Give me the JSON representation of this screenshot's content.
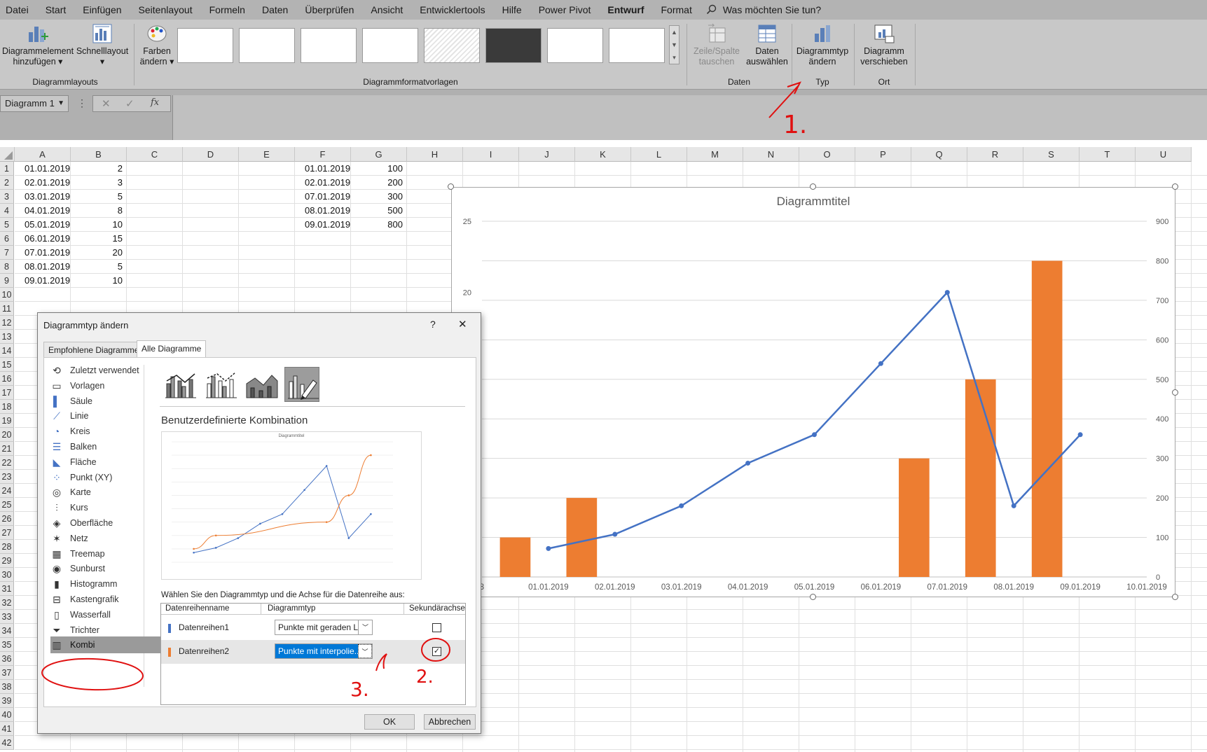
{
  "menu": {
    "items": [
      "Datei",
      "Start",
      "Einfügen",
      "Seitenlayout",
      "Formeln",
      "Daten",
      "Überprüfen",
      "Ansicht",
      "Entwicklertools",
      "Hilfe",
      "Power Pivot",
      "Entwurf",
      "Format"
    ],
    "active": "Entwurf",
    "search_placeholder": "Was möchten Sie tun?"
  },
  "ribbon": {
    "add_element": [
      "Diagrammelement",
      "hinzufügen"
    ],
    "quick_layout": "Schnelllayout",
    "change_colors": [
      "Farben",
      "ändern"
    ],
    "group_layouts": "Diagrammlayouts",
    "group_styles": "Diagrammformatvorlagen",
    "switch_rowcol": [
      "Zeile/Spalte",
      "tauschen"
    ],
    "select_data": [
      "Daten",
      "auswählen"
    ],
    "group_data": "Daten",
    "change_type": [
      "Diagrammtyp",
      "ändern"
    ],
    "group_type": "Typ",
    "move_chart": [
      "Diagramm",
      "verschieben"
    ],
    "group_location": "Ort"
  },
  "formula_bar": {
    "name_box": "Diagramm 1",
    "fx": "fx"
  },
  "sheet": {
    "columns": [
      "A",
      "B",
      "C",
      "D",
      "E",
      "F",
      "G",
      "H",
      "I",
      "J",
      "K",
      "L",
      "M",
      "N",
      "O",
      "P",
      "Q",
      "R",
      "S",
      "T",
      "U"
    ],
    "rows": [
      "1",
      "2",
      "3",
      "4",
      "5",
      "6",
      "7",
      "8",
      "9",
      "10",
      "11",
      "12",
      "13",
      "14",
      "15",
      "16",
      "17",
      "18",
      "19",
      "20",
      "21",
      "22",
      "23",
      "24",
      "25",
      "26",
      "27",
      "28",
      "29",
      "30",
      "31",
      "32",
      "33",
      "34",
      "35",
      "36",
      "37",
      "38",
      "39",
      "40",
      "41",
      "42"
    ],
    "col_a": [
      "01.01.2019",
      "02.01.2019",
      "03.01.2019",
      "04.01.2019",
      "05.01.2019",
      "06.01.2019",
      "07.01.2019",
      "08.01.2019",
      "09.01.2019"
    ],
    "col_b": [
      "2",
      "3",
      "5",
      "8",
      "10",
      "15",
      "20",
      "5",
      "10"
    ],
    "col_f": [
      "01.01.2019",
      "02.01.2019",
      "07.01.2019",
      "08.01.2019",
      "09.01.2019"
    ],
    "col_g": [
      "100",
      "200",
      "300",
      "500",
      "800"
    ]
  },
  "chart_data": {
    "type": "bar",
    "title": "Diagrammtitel",
    "x_tick_labels": [
      "2018",
      "01.01.2019",
      "02.01.2019",
      "03.01.2019",
      "04.01.2019",
      "05.01.2019",
      "06.01.2019",
      "07.01.2019",
      "08.01.2019",
      "09.01.2019",
      "10.01.2019"
    ],
    "y_left_ticks": [
      "25",
      "20"
    ],
    "y_right_ticks": [
      "900",
      "800",
      "700",
      "600",
      "500",
      "400",
      "300",
      "200",
      "100",
      "0"
    ],
    "ylim_left": [
      0,
      25
    ],
    "ylim_right": [
      0,
      900
    ],
    "grid": true,
    "series": [
      {
        "chart": "line",
        "axis": "primary",
        "color": "#4472c4",
        "x": [
          "01.01.2019",
          "02.01.2019",
          "03.01.2019",
          "04.01.2019",
          "05.01.2019",
          "06.01.2019",
          "07.01.2019",
          "08.01.2019",
          "09.01.2019"
        ],
        "values": [
          2,
          3,
          5,
          8,
          10,
          15,
          20,
          5,
          10
        ]
      },
      {
        "chart": "bar",
        "axis": "secondary",
        "color": "#ed7d31",
        "x": [
          "01.01.2019",
          "02.01.2019",
          "07.01.2019",
          "08.01.2019",
          "09.01.2019"
        ],
        "values": [
          100,
          200,
          300,
          500,
          800
        ]
      }
    ]
  },
  "dialog": {
    "title": "Diagrammtyp ändern",
    "help": "?",
    "close": "✕",
    "tabs": [
      "Empfohlene Diagramme",
      "Alle Diagramme"
    ],
    "categories": [
      "Zuletzt verwendet",
      "Vorlagen",
      "Säule",
      "Linie",
      "Kreis",
      "Balken",
      "Fläche",
      "Punkt (XY)",
      "Karte",
      "Kurs",
      "Oberfläche",
      "Netz",
      "Treemap",
      "Sunburst",
      "Histogramm",
      "Kastengrafik",
      "Wasserfall",
      "Trichter",
      "Kombi"
    ],
    "selected_category": "Kombi",
    "combo_heading": "Benutzerdefinierte Kombination",
    "preview_title": "Diagrammtitel",
    "series_prompt": "Wählen Sie den Diagrammtyp und die Achse für die Datenreihe aus:",
    "table_headers": [
      "Datenreihenname",
      "Diagrammtyp",
      "Sekundärachse"
    ],
    "rows": [
      {
        "name": "Datenreihen1",
        "type": "Punkte mit geraden L...",
        "secondary": false,
        "color": "#4472c4"
      },
      {
        "name": "Datenreihen2",
        "type": "Punkte mit interpolie...",
        "secondary": true,
        "color": "#ed7d31"
      }
    ],
    "ok": "OK",
    "cancel": "Abbrechen"
  },
  "annotations": [
    "1.",
    "2.",
    "3."
  ]
}
